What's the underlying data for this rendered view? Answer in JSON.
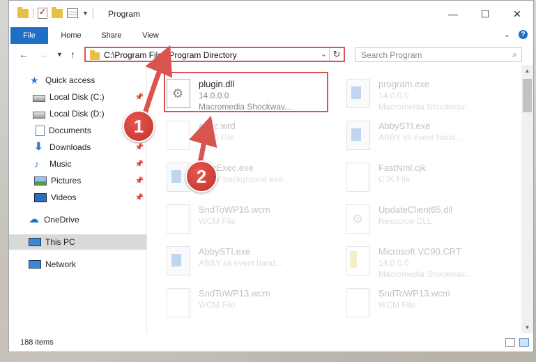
{
  "window": {
    "title": "Program",
    "controls": {
      "minimize": "—",
      "maximize": "☐",
      "close": "✕"
    }
  },
  "ribbon": {
    "tabs": [
      "File",
      "Home",
      "Share",
      "View"
    ]
  },
  "address_bar": {
    "path": "C:\\Program Files\\Program Directory"
  },
  "search": {
    "placeholder": "Search Program"
  },
  "sidebar": {
    "items": [
      {
        "label": "Quick access",
        "icon": "star-icon"
      },
      {
        "label": "Local Disk (C:)",
        "icon": "disk-icon",
        "pinned": true
      },
      {
        "label": "Local Disk (D:)",
        "icon": "disk-icon"
      },
      {
        "label": "Documents",
        "icon": "documents-icon",
        "pinned": true
      },
      {
        "label": "Downloads",
        "icon": "downloads-icon",
        "pinned": true
      },
      {
        "label": "Music",
        "icon": "music-icon",
        "pinned": true
      },
      {
        "label": "Pictures",
        "icon": "pictures-icon",
        "pinned": true
      },
      {
        "label": "Videos",
        "icon": "videos-icon",
        "pinned": true
      },
      {
        "label": "OneDrive",
        "icon": "onedrive-icon"
      },
      {
        "label": "This PC",
        "icon": "this-pc-icon",
        "selected": true
      },
      {
        "label": "Network",
        "icon": "network-icon"
      }
    ]
  },
  "files": [
    {
      "name": "plugin.dll",
      "line1": "14.0.0.0",
      "line2": "Macromedia Shockwav...",
      "icon": "dll-gear-icon",
      "highlighted": true
    },
    {
      "name": "program.exe",
      "line1": "14.0.0.0",
      "line2": "Macromedia Shockwav...",
      "icon": "exe-icon"
    },
    {
      "name": "abpc.wrd",
      "line1": "WRD File",
      "line2": "",
      "icon": "document-icon"
    },
    {
      "name": "AbbySTI.exe",
      "line1": "ABBY sti event hand...",
      "line2": "",
      "icon": "exe-icon"
    },
    {
      "name": "FineExec.exe",
      "line1": "ABBY background exe...",
      "line2": "",
      "icon": "exe-icon"
    },
    {
      "name": "FastNml.cjk",
      "line1": "CJK File",
      "line2": "",
      "icon": "document-icon"
    },
    {
      "name": "SndToWP16.wcm",
      "line1": "WCM File",
      "line2": "",
      "icon": "document-icon"
    },
    {
      "name": "UpdateClient65.dll",
      "line1": "Resource DLL",
      "line2": "",
      "icon": "dll-gear-icon"
    },
    {
      "name": "AbbySTI.exe",
      "line1": "ABBY sti event hand...",
      "line2": "",
      "icon": "exe-icon"
    },
    {
      "name": "Microsoft VC90.CRT",
      "line1": "14.0.0.0",
      "line2": "Macromedia Shockwav...",
      "icon": "folder-document-icon"
    },
    {
      "name": "SndToWP13.wcm",
      "line1": "WCM File",
      "line2": "",
      "icon": "document-icon"
    },
    {
      "name": "SndToWP13.wcm",
      "line1": "WCM File",
      "line2": "",
      "icon": "document-icon"
    }
  ],
  "status": {
    "item_count": "188 items"
  },
  "annotations": {
    "badge_1": "1",
    "badge_2": "2",
    "arrow_color": "#d9534f"
  }
}
